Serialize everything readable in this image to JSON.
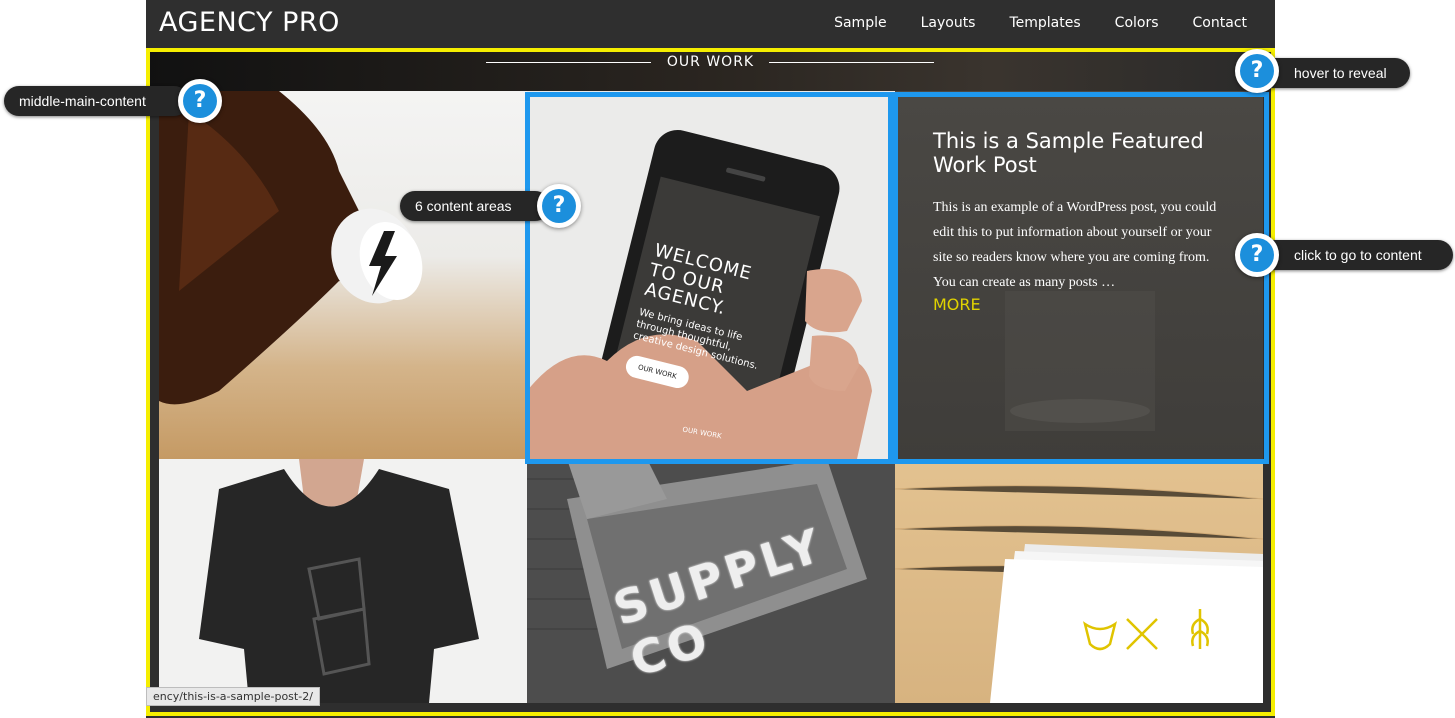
{
  "site": {
    "logo": "AGENCY PRO",
    "nav": [
      "Sample",
      "Layouts",
      "Templates",
      "Colors",
      "Contact"
    ],
    "section_title": "OUR WORK"
  },
  "phone": {
    "headline": "WELCOME TO OUR AGENCY.",
    "tagline": "We bring ideas to life through thoughtful, creative design solutions.",
    "button": "OUR WORK",
    "footer_label": "OUR WORK"
  },
  "featured": {
    "title": "This is a Sample Featured Work Post",
    "excerpt": "This is an example of a WordPress post, you could edit this to put information about yourself or your site so readers know where you are coming from. You can create as many posts …",
    "more": "MORE"
  },
  "sign_text": "SUPPLY CO",
  "status_url": "ency/this-is-a-sample-post-2/",
  "annotations": {
    "middle_main_content": "middle-main-content",
    "content_areas": "6 content areas",
    "hover_to_reveal": "hover to reveal",
    "click_to_content": "click to go to content",
    "badge_glyph": "?"
  },
  "colors": {
    "yellow_highlight": "#f5ee00",
    "blue_highlight": "#1e98ee",
    "more_link": "#e1d300",
    "badge_blue": "#1c8fdc"
  },
  "icons": [
    "bottle-cap-bolt-icon",
    "bull-head-icon",
    "fork-knife-icon",
    "wheat-icon"
  ]
}
